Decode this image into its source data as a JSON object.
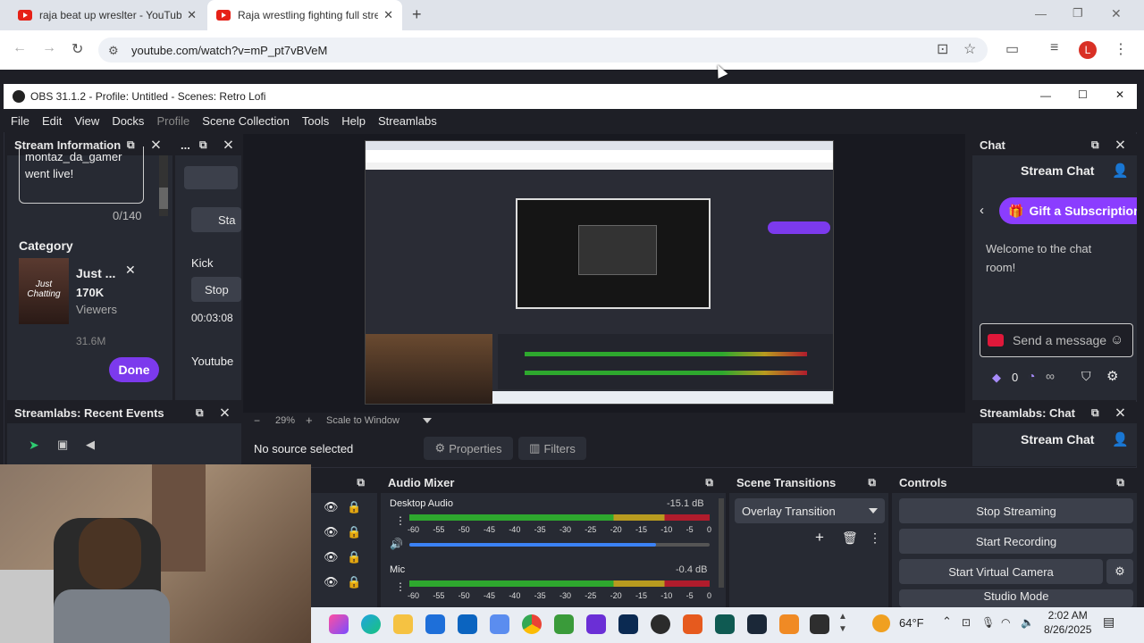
{
  "browser": {
    "tabs": [
      {
        "label": "raja beat up wreslter - YouTube"
      },
      {
        "label": "Raja wrestling fighting full strea"
      }
    ],
    "url": "youtube.com/watch?v=mP_pt7vBVeM",
    "avatar_letter": "L"
  },
  "obs": {
    "title": "OBS 31.1.2 - Profile: Untitled - Scenes: Retro Lofi",
    "menu": [
      "File",
      "Edit",
      "View",
      "Docks",
      "Profile",
      "Scene Collection",
      "Tools",
      "Help",
      "Streamlabs"
    ],
    "stream_info": {
      "title": "Stream Information",
      "text_line1": "montaz_da_gamer",
      "text_line2": "went live!",
      "char_count": "0/140",
      "category_label": "Category",
      "category_name": "Just ...",
      "category_viewers": "170K",
      "category_viewers_label": "Viewers",
      "category_extra": "31.6M",
      "thumb_text": "Just Chatting",
      "done_label": "Done"
    },
    "mini_panel": {
      "title": "...",
      "start_label": "Sta",
      "kick_label": "Kick",
      "stop_label": "Stop",
      "timer": "00:03:08",
      "youtube_label": "Youtube"
    },
    "recent_events": {
      "title": "Streamlabs: Recent Events"
    },
    "preview": {
      "zoom": "29%",
      "scale_label": "Scale to Window"
    },
    "source_bar": {
      "no_source": "No source selected",
      "properties": "Properties",
      "filters": "Filters"
    },
    "audio_mixer": {
      "title": "Audio Mixer",
      "channels": [
        {
          "name": "Desktop Audio",
          "db": "-15.1 dB",
          "level": 0.82
        },
        {
          "name": "Mic",
          "db": "-0.4 dB",
          "level": 0.95
        }
      ],
      "scale": [
        "-60",
        "-55",
        "-50",
        "-45",
        "-40",
        "-35",
        "-30",
        "-25",
        "-20",
        "-15",
        "-10",
        "-5",
        "0"
      ]
    },
    "scene_transitions": {
      "title": "Scene Transitions",
      "selected": "Overlay Transition"
    },
    "controls": {
      "title": "Controls",
      "buttons": [
        "Stop Streaming",
        "Start Recording",
        "Start Virtual Camera",
        "Studio Mode"
      ]
    },
    "chat": {
      "title": "Chat",
      "stream_chat": "Stream Chat",
      "gift_label": "Gift a Subscription",
      "welcome": "Welcome to the chat room!",
      "send_placeholder": "Send a message",
      "count": "0",
      "infinity": "∞"
    },
    "sl_chat": {
      "title": "Streamlabs: Chat",
      "stream_chat": "Stream Chat"
    }
  },
  "taskbar": {
    "weather": "64°F",
    "time": "2:02 AM",
    "date": "8/26/2025"
  },
  "colors": {
    "accent": "#7c3aed",
    "meter_green": "#2ea82e",
    "meter_yellow": "#b89b1f",
    "meter_red": "#b01c2c"
  }
}
